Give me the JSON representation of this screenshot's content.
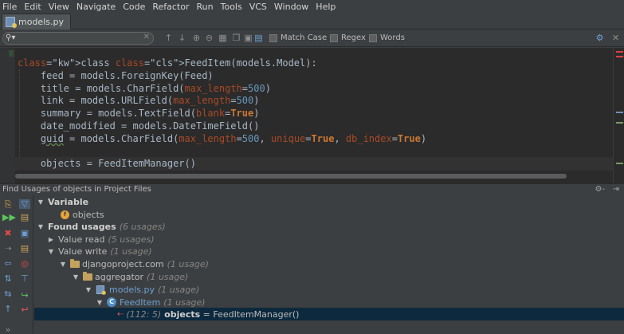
{
  "menu": [
    "File",
    "Edit",
    "View",
    "Navigate",
    "Code",
    "Refactor",
    "Run",
    "Tools",
    "VCS",
    "Window",
    "Help"
  ],
  "tab": {
    "label": "models.py"
  },
  "search": {
    "value": "",
    "options": {
      "match_case": "Match Case",
      "regex": "Regex",
      "words": "Words"
    }
  },
  "editor": {
    "lines": [
      "class FeedItem(models.Model):",
      "    feed = models.ForeignKey(Feed)",
      "    title = models.CharField(max_length=500)",
      "    link = models.URLField(max_length=500)",
      "    summary = models.TextField(blank=True)",
      "    date_modified = models.DateTimeField()",
      "    guid = models.CharField(max_length=500, unique=True, db_index=True)",
      "",
      "    objects = FeedItemManager()"
    ]
  },
  "find_usages": {
    "title": "Find Usages of objects in Project Files",
    "variable_label": "Variable",
    "variable_name": "objects",
    "found_label": "Found usages",
    "found_count": "(6 usages)",
    "value_read": "Value read",
    "value_read_count": "(5 usages)",
    "value_write": "Value write",
    "value_write_count": "(1 usage)",
    "project": "djangoproject.com",
    "project_count": "(1 usage)",
    "package": "aggregator",
    "package_count": "(1 usage)",
    "file": "models.py",
    "file_count": "(1 usage)",
    "class": "FeedItem",
    "class_count": "(1 usage)",
    "usage_loc": "(112: 5)",
    "usage_name": "objects",
    "usage_rest": " = FeedItemManager()"
  },
  "colors": {
    "accent": "#0d293e",
    "keyword": "#cc7832",
    "number": "#6897bb"
  }
}
